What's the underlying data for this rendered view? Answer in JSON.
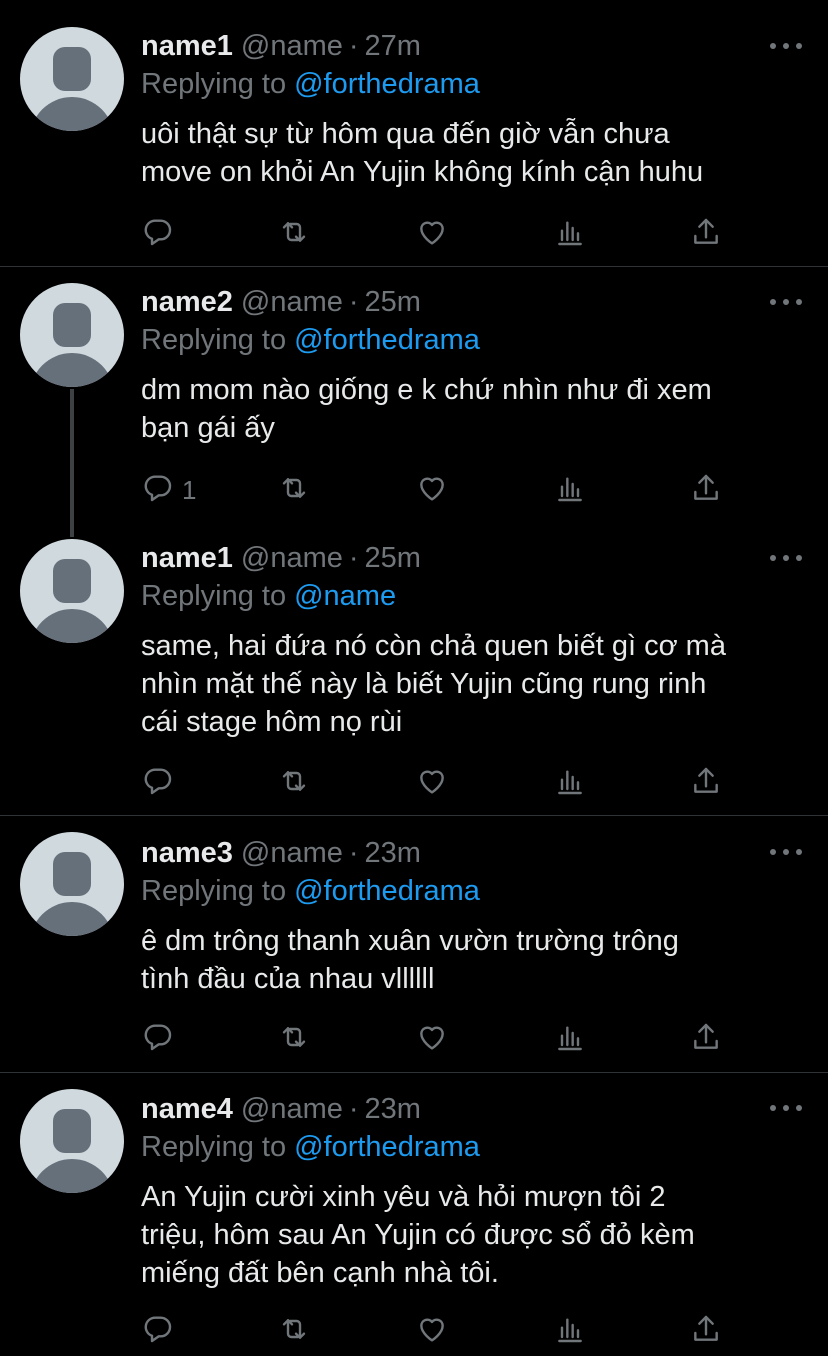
{
  "tweets": [
    {
      "name": "name1",
      "handle": "@name",
      "time": "27m",
      "replying_label": "Replying to",
      "replying_to": "@forthedrama",
      "lines": [
        "uôi thật sự từ hôm qua đến giờ vẫn chưa",
        "move on khỏi An Yujin không kính cận huhu"
      ],
      "reply_count": ""
    },
    {
      "name": "name2",
      "handle": "@name",
      "time": "25m",
      "replying_label": "Replying to",
      "replying_to": "@forthedrama",
      "lines": [
        "dm mom nào giống e k chứ nhìn như đi xem",
        "bạn gái ấy"
      ],
      "reply_count": "1"
    },
    {
      "name": "name1",
      "handle": "@name",
      "time": "25m",
      "replying_label": "Replying to",
      "replying_to": "@name",
      "lines": [
        "same, hai đứa nó còn chả quen biết gì cơ mà",
        "nhìn mặt thế này là biết Yujin cũng rung rinh",
        "cái stage hôm nọ rùi"
      ],
      "reply_count": ""
    },
    {
      "name": "name3",
      "handle": "@name",
      "time": "23m",
      "replying_label": "Replying to",
      "replying_to": "@forthedrama",
      "lines": [
        "ê dm trông thanh xuân vườn trường trông",
        "tình đầu của nhau vllllll"
      ],
      "reply_count": ""
    },
    {
      "name": "name4",
      "handle": "@name",
      "time": "23m",
      "replying_label": "Replying to",
      "replying_to": "@forthedrama",
      "lines": [
        "An Yujin cười xinh yêu và hỏi mượn tôi 2",
        "triệu, hôm sau An Yujin có được sổ đỏ kèm",
        "miếng đất bên cạnh nhà tôi."
      ],
      "reply_count": ""
    }
  ],
  "icons": {
    "reply": "reply-icon",
    "retweet": "retweet-icon",
    "like": "like-icon",
    "analytics": "analytics-icon",
    "share": "share-icon",
    "more": "more-icon"
  },
  "colors": {
    "background": "#000000",
    "mention": "#1d9bf0",
    "muted": "#71767b",
    "text": "#e7e9ea"
  }
}
